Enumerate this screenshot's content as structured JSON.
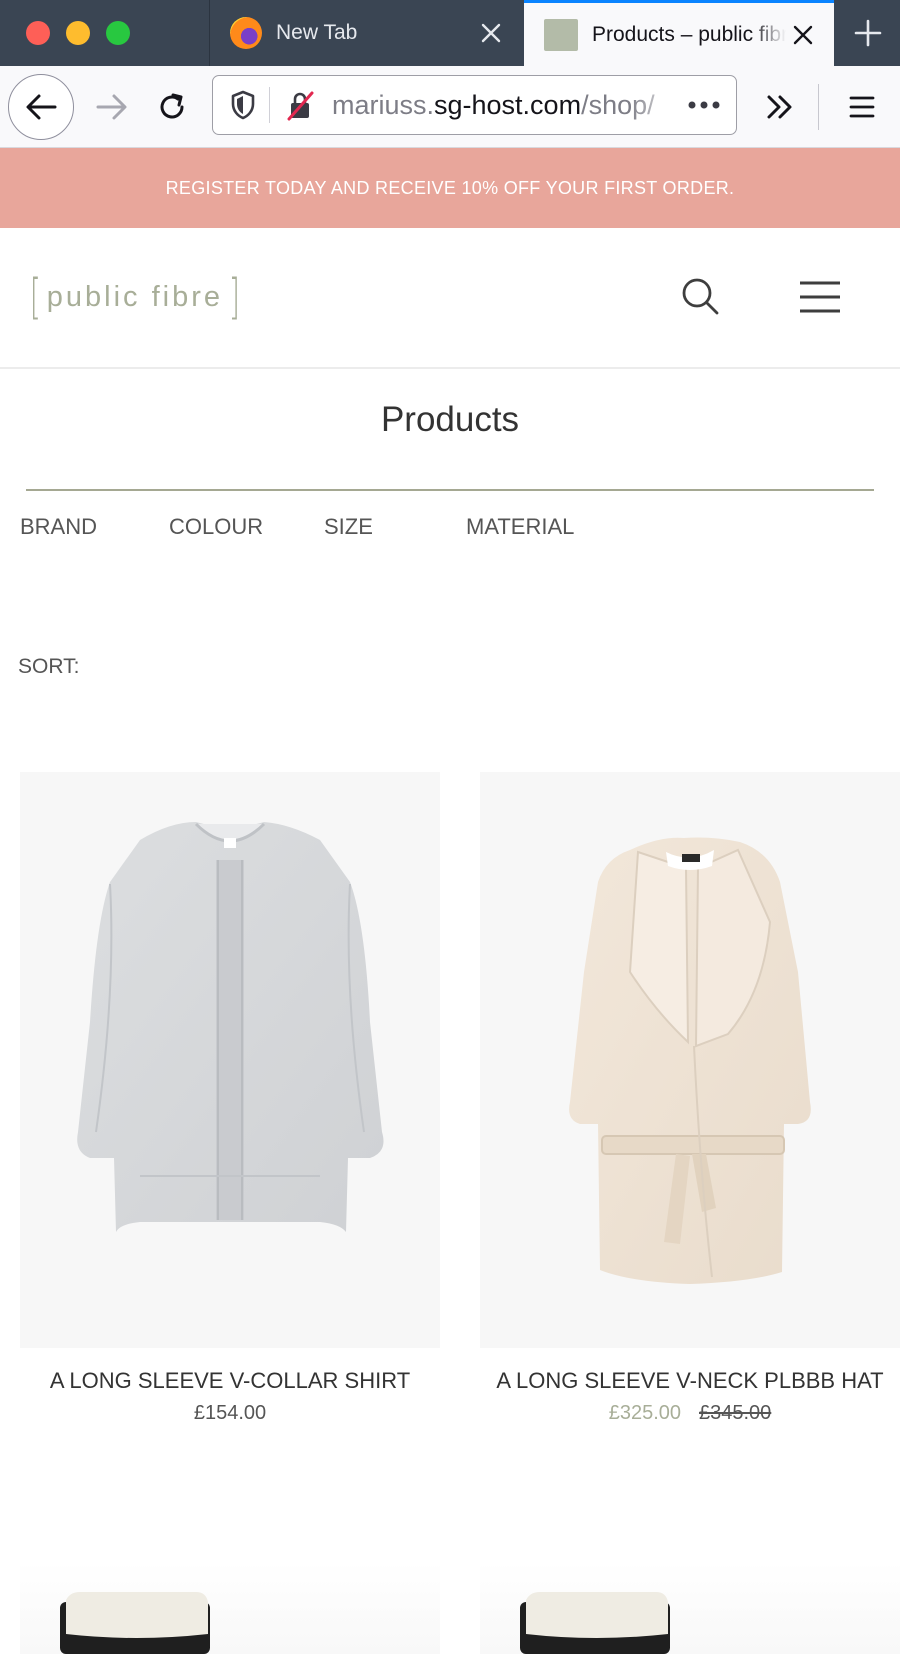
{
  "browser": {
    "tabs": [
      {
        "title": "New Tab",
        "favicon": "firefox-icon",
        "active": false
      },
      {
        "title": "Products – public fibre",
        "favicon": "site-swatch-icon",
        "active": true
      }
    ],
    "url": {
      "prefix": "mariuss.",
      "host": "sg-host.com",
      "path": "/shop/"
    }
  },
  "site": {
    "promo": "REGISTER TODAY AND RECEIVE 10% OFF YOUR FIRST ORDER.",
    "logo": {
      "bracket_open": "[",
      "text": "public fibre",
      "bracket_close": "]"
    },
    "page_title": "Products",
    "filters": [
      "BRAND",
      "COLOUR",
      "SIZE",
      "MATERIAL"
    ],
    "sort_label": "SORT:"
  },
  "products": [
    {
      "name": "A LONG SLEEVE V-COLLAR SHIRT",
      "price": "£154.00",
      "image": "grey-coat-image"
    },
    {
      "name": "A LONG SLEEVE V-NECK PLBBB HAT",
      "sale_price": "£325.00",
      "original_price": "£345.00",
      "image": "cream-belted-coat-image"
    }
  ],
  "colors": {
    "promo_bg": "#e8a69b",
    "logo": "#a8ae98",
    "sale_price": "#a8ae98",
    "tab_active_accent": "#0a84ff"
  }
}
